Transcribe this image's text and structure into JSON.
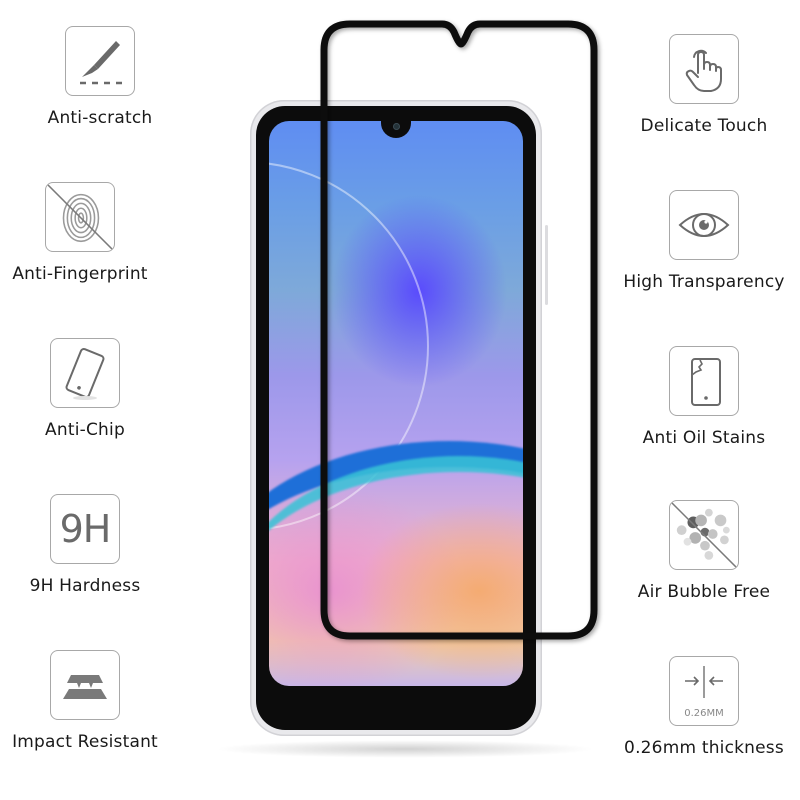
{
  "left_features": [
    {
      "label": "Anti-scratch",
      "icon": "scalpel-icon"
    },
    {
      "label": "Anti-Fingerprint",
      "icon": "fingerprint-crossed-icon"
    },
    {
      "label": "Anti-Chip",
      "icon": "tilted-phone-icon"
    },
    {
      "label": "9H Hardness",
      "icon": "9h-icon",
      "icon_text": "9H"
    },
    {
      "label": "Impact Resistant",
      "icon": "layered-plates-icon"
    }
  ],
  "right_features": [
    {
      "label": "Delicate Touch",
      "icon": "touch-hand-icon"
    },
    {
      "label": "High Transparency",
      "icon": "eye-icon"
    },
    {
      "label": "Anti Oil Stains",
      "icon": "cracked-phone-icon"
    },
    {
      "label": "Air Bubble Free",
      "icon": "bubbles-crossed-icon"
    },
    {
      "label": "0.26mm thickness",
      "icon": "thickness-arrows-icon",
      "icon_text": "0.26MM"
    }
  ],
  "colors": {
    "icon_gray": "#6a6a6a",
    "icon_border": "#a8a8a8",
    "label_text": "#1a1a1a",
    "protector_edge": "#0a0a0a"
  }
}
